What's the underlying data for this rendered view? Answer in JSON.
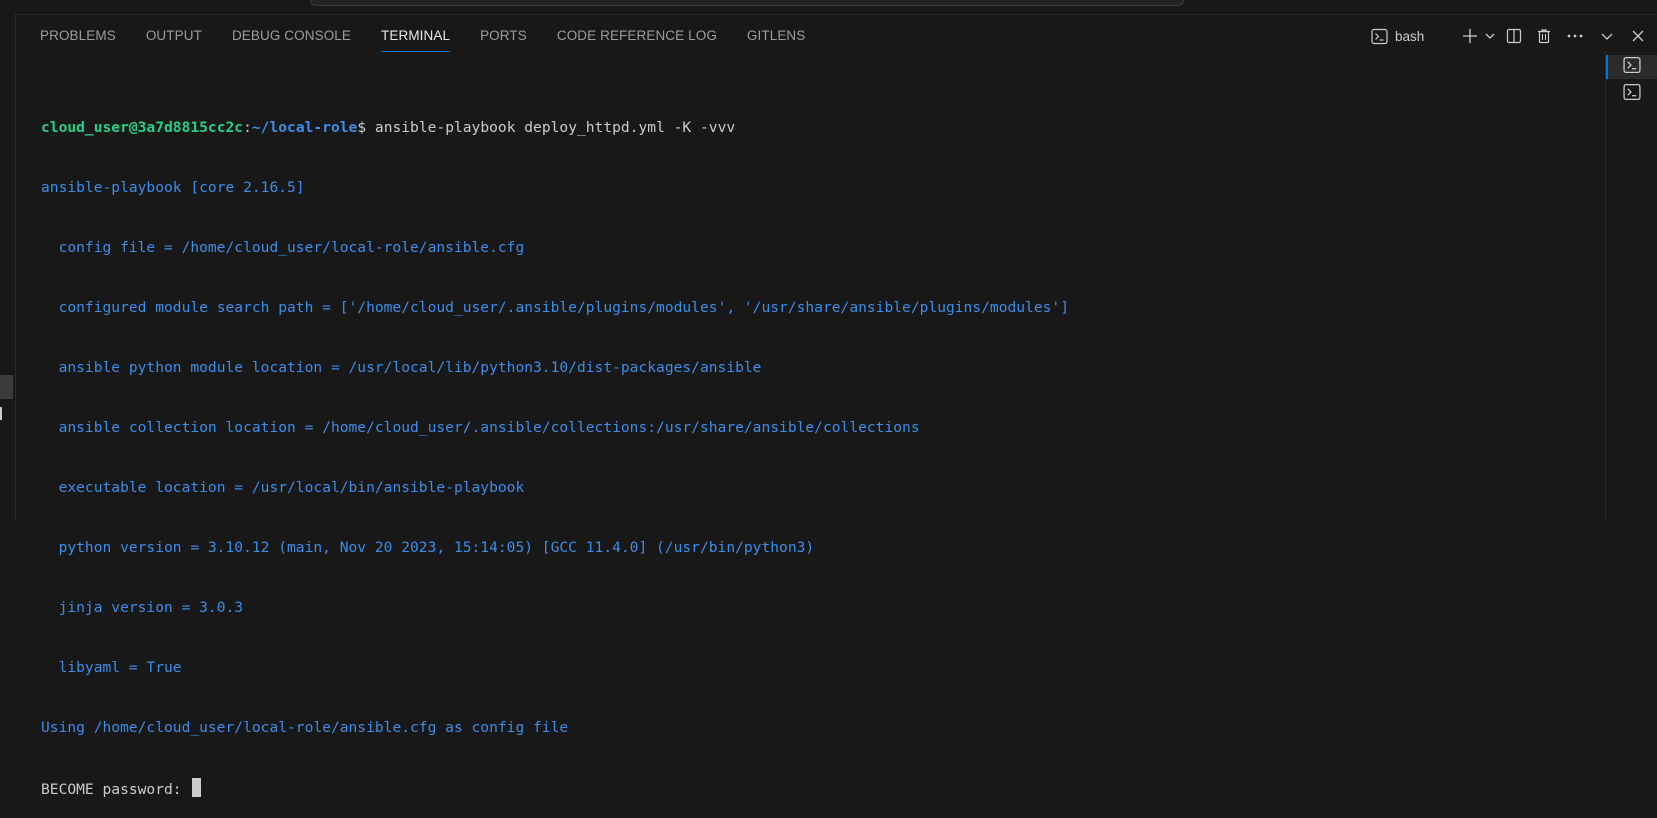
{
  "panel": {
    "tabs": [
      {
        "label": "PROBLEMS",
        "active": false
      },
      {
        "label": "OUTPUT",
        "active": false
      },
      {
        "label": "DEBUG CONSOLE",
        "active": false
      },
      {
        "label": "TERMINAL",
        "active": true
      },
      {
        "label": "PORTS",
        "active": false
      },
      {
        "label": "CODE REFERENCE LOG",
        "active": false
      },
      {
        "label": "GITLENS",
        "active": false
      }
    ],
    "active_terminal": "bash"
  },
  "icons": {
    "terminal": "terminal-icon",
    "new": "plus-icon",
    "dropdown": "chevron-down-icon",
    "split": "split-editor-icon",
    "kill": "trash-icon",
    "more": "ellipsis-icon",
    "minimize": "chevron-down-icon",
    "close": "close-icon"
  },
  "terminal": {
    "prompt_user": "cloud_user@3a7d8815cc2c",
    "prompt_sep": ":",
    "prompt_path": "~/local-role",
    "prompt_symbol": "$ ",
    "command": "ansible-playbook deploy_httpd.yml -K -vvv",
    "output_lines": [
      "ansible-playbook [core 2.16.5]",
      "  config file = /home/cloud_user/local-role/ansible.cfg",
      "  configured module search path = ['/home/cloud_user/.ansible/plugins/modules', '/usr/share/ansible/plugins/modules']",
      "  ansible python module location = /usr/local/lib/python3.10/dist-packages/ansible",
      "  ansible collection location = /home/cloud_user/.ansible/collections:/usr/share/ansible/collections",
      "  executable location = /usr/local/bin/ansible-playbook",
      "  python version = 3.10.12 (main, Nov 20 2023, 15:14:05) [GCC 11.4.0] (/usr/bin/python3)",
      "  jinja version = 3.0.3",
      "  libyaml = True",
      "Using /home/cloud_user/local-role/ansible.cfg as config file"
    ],
    "input_prompt": "BECOME password: "
  },
  "colors": {
    "background": "#181818",
    "prompt_user": "#23d18b",
    "prompt_path": "#3b8eea",
    "output": "#3b8eea",
    "text": "#cccccc",
    "accent": "#0078d4"
  }
}
